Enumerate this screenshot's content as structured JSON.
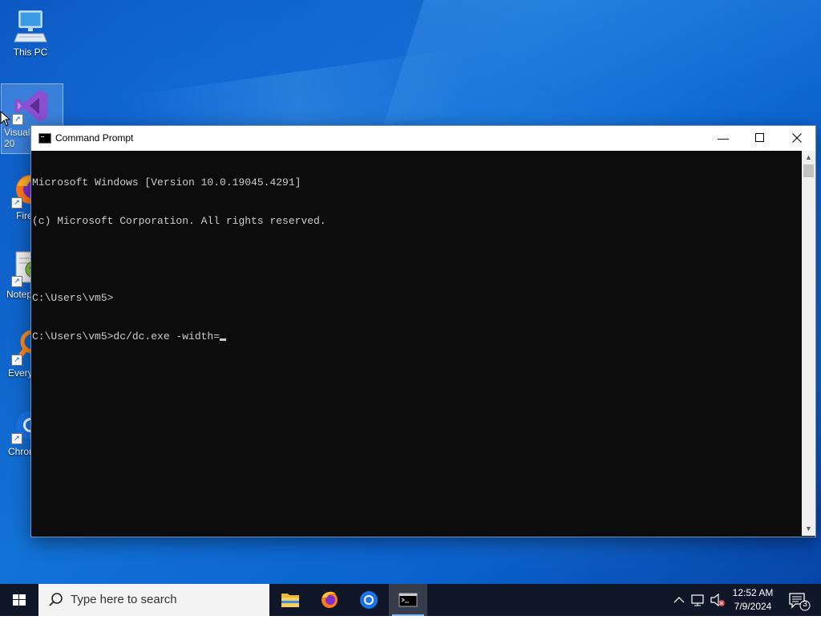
{
  "desktop": {
    "icons": [
      {
        "label": "This PC",
        "icon": "computer-icon"
      },
      {
        "label": "Visual\n20",
        "icon": "visual-studio-icon"
      },
      {
        "label": "Fire",
        "icon": "firefox-icon"
      },
      {
        "label": "Notep",
        "icon": "notepad-plus-plus-icon"
      },
      {
        "label": "Every",
        "icon": "everything-search-icon"
      },
      {
        "label": "Chron",
        "icon": "chrome-icon"
      }
    ]
  },
  "cmd_window": {
    "title": "Command Prompt",
    "minimize_glyph": "—",
    "maximize_glyph": "☐",
    "close_glyph": "✕",
    "lines": [
      "Microsoft Windows [Version 10.0.19045.4291]",
      "(c) Microsoft Corporation. All rights reserved.",
      "",
      "C:\\Users\\vm5>",
      "C:\\Users\\vm5>dc/dc.exe -width="
    ]
  },
  "taskbar": {
    "search_placeholder": "Type here to search",
    "apps": [
      {
        "name": "file-explorer",
        "icon": "folder-icon"
      },
      {
        "name": "firefox",
        "icon": "firefox-icon"
      },
      {
        "name": "chrome",
        "icon": "chrome-icon"
      },
      {
        "name": "command-prompt",
        "icon": "terminal-icon",
        "active": true
      }
    ],
    "clock": {
      "time": "12:52 AM",
      "date": "7/9/2024"
    },
    "notification_count": "3"
  }
}
